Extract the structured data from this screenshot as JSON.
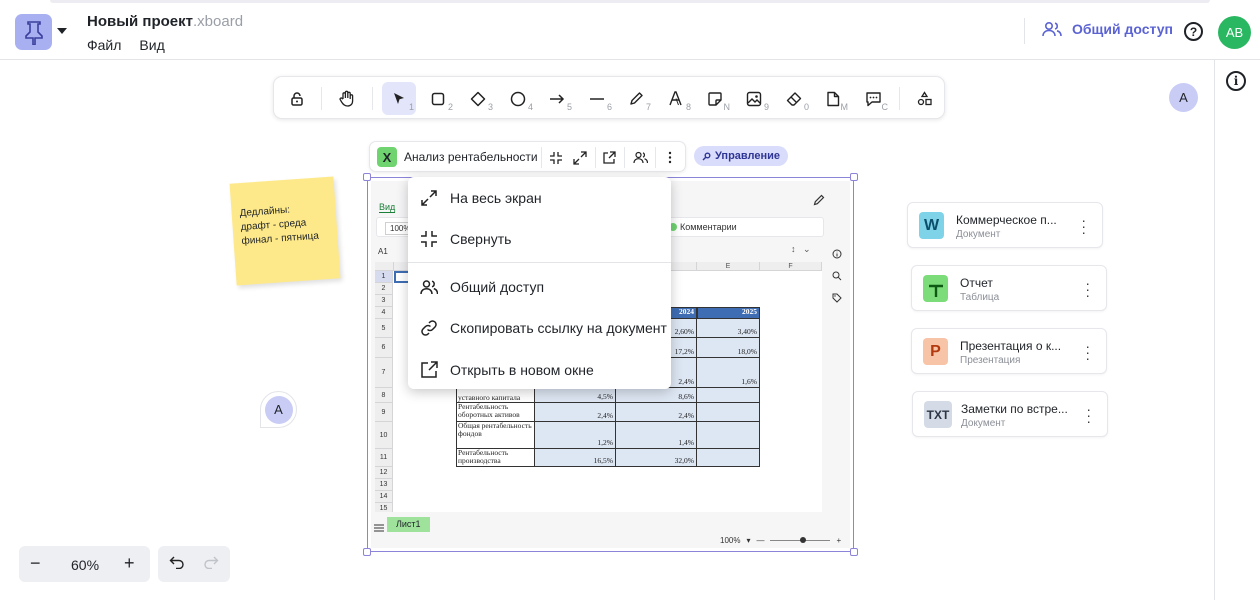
{
  "header": {
    "title": "Новый проект",
    "extension": ".xboard",
    "menu": [
      "Файл",
      "Вид"
    ],
    "share_label": "Общий доступ",
    "help": "?",
    "avatar": "AB"
  },
  "toolbar": {
    "hotkeys": [
      "1",
      "2",
      "3",
      "4",
      "5",
      "6",
      "7",
      "8",
      "N",
      "9",
      "0",
      "M",
      "C"
    ]
  },
  "peers": {
    "top_right": "A",
    "left": "A"
  },
  "frame": {
    "app_letter": "X",
    "name": "Анализ рентабельности",
    "manage_badge": "Управление"
  },
  "sticky": {
    "text_lines": [
      "Дедлайны:",
      "драфт - среда",
      "финал - пятница"
    ]
  },
  "sheet": {
    "tab_vid": "Вид",
    "zoom": "100%",
    "comments": "Комментарии",
    "cell_ref": "A1",
    "columns": [
      "E",
      "F"
    ],
    "rows": [
      "1",
      "2",
      "3",
      "4",
      "5",
      "6",
      "7",
      "8",
      "9",
      "10",
      "11",
      "12",
      "13",
      "14",
      "15"
    ],
    "header_years": [
      "2024",
      "2025"
    ],
    "labels": [
      "уставного капитала",
      "Рентабельность оборотных активов",
      "Общая рентабельность фондов",
      "Рентабельность производства"
    ],
    "values": {
      "r5": [
        "2,60%",
        "3,40%"
      ],
      "r6": [
        "17,2%",
        "18,0%"
      ],
      "r7": [
        "2,4%",
        "1,6%"
      ],
      "r8": [
        "4,5%",
        "8,6%"
      ],
      "r9": [
        "2,4%",
        "2,4%"
      ],
      "r10": [
        "1,2%",
        "1,4%"
      ],
      "r11": [
        "16,5%",
        "32,0%"
      ]
    },
    "sheet_tab": "Лист1",
    "zoom_bottom": "100%"
  },
  "context_menu": {
    "items": [
      "На весь экран",
      "Свернуть",
      "Общий доступ",
      "Скопировать ссылку на документ",
      "Открыть в новом окне"
    ]
  },
  "cards": [
    {
      "letter": "W",
      "name": "Коммерческое п...",
      "type": "Документ",
      "bg": "#7fd3e8",
      "fg": "#0b4f6c"
    },
    {
      "letter": "T",
      "name": "Отчет",
      "type": "Таблица",
      "bg": "#7ddc7a",
      "fg": "#0e5a15"
    },
    {
      "letter": "P",
      "name": "Презентация о к...",
      "type": "Презентация",
      "bg": "#f7c4a8",
      "fg": "#b23a0e"
    },
    {
      "letter": "TXT",
      "name": "Заметки по встре...",
      "type": "Документ",
      "bg": "#d5dbe6",
      "fg": "#2b3546"
    }
  ],
  "zoom": {
    "value": "60%",
    "minus": "−",
    "plus": "+"
  },
  "colors": {
    "accent": "#5b63d3",
    "logo_bg": "#a9b0f2",
    "avatar_bg": "#2ab761",
    "selection": "#8b84d8"
  }
}
